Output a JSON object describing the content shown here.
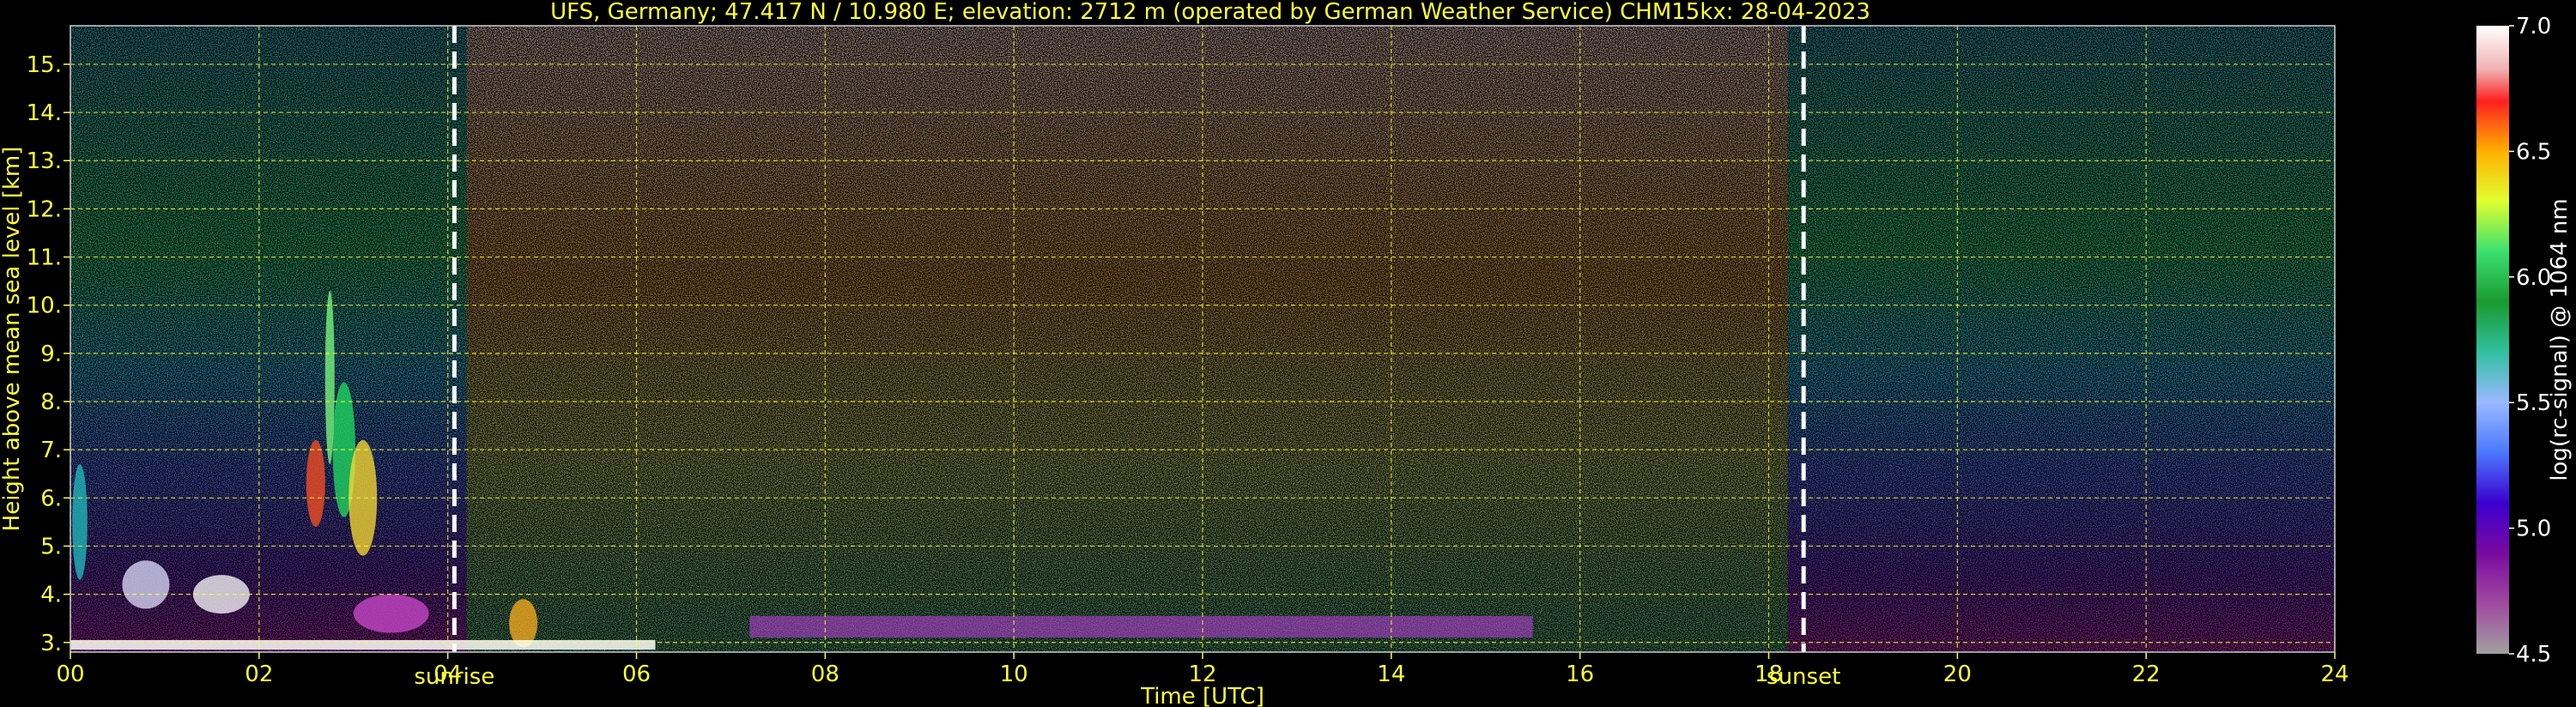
{
  "chart_data": {
    "type": "heatmap",
    "title": "UFS, Germany; 47.417 N / 10.980 E; elevation: 2712 m  (operated by German Weather Service)    CHM15kx: 28-04-2023",
    "xlabel": "Time [UTC]",
    "ylabel": "Height above mean sea level [km]",
    "xlim": [
      0,
      24
    ],
    "ylim": [
      2.8,
      15.8
    ],
    "x_ticks": [
      "00",
      "02",
      "04",
      "06",
      "08",
      "10",
      "12",
      "14",
      "16",
      "18",
      "20",
      "22",
      "24"
    ],
    "x_tick_values": [
      0,
      2,
      4,
      6,
      8,
      10,
      12,
      14,
      16,
      18,
      20,
      22,
      24
    ],
    "y_ticks": [
      "3.",
      "4.",
      "5.",
      "6.",
      "7.",
      "8.",
      "9.",
      "10.",
      "11.",
      "12.",
      "13.",
      "14.",
      "15."
    ],
    "y_tick_values": [
      3,
      4,
      5,
      6,
      7,
      8,
      9,
      10,
      11,
      12,
      13,
      14,
      15
    ],
    "grid": true,
    "colorbar": {
      "label": "log(rc-signal) @ 1064 nm",
      "range": [
        4.5,
        7.0
      ],
      "ticks": [
        "4.5",
        "5.0",
        "5.5",
        "6.0",
        "6.5",
        "7.0"
      ],
      "tick_values": [
        4.5,
        5.0,
        5.5,
        6.0,
        6.5,
        7.0
      ]
    },
    "annotations": [
      {
        "label": "sunrise",
        "x": 4.07
      },
      {
        "label": "sunset",
        "x": 18.37
      }
    ],
    "colors": {
      "axis_text": "#ffff33",
      "grid": "#ffff33",
      "background": "#000000",
      "marker_lines": "#ffffff"
    }
  }
}
